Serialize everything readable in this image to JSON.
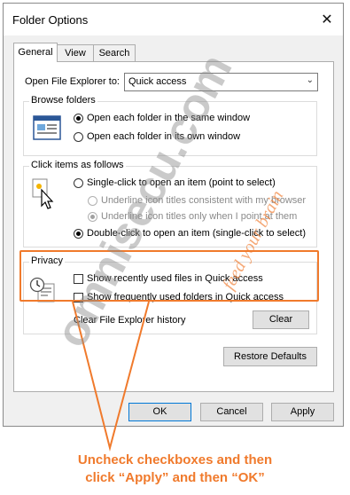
{
  "window": {
    "title": "Folder Options",
    "close_icon": "close-icon"
  },
  "tabs": [
    {
      "label": "General",
      "active": true
    },
    {
      "label": "View",
      "active": false
    },
    {
      "label": "Search",
      "active": false
    }
  ],
  "open_explorer": {
    "label": "Open File Explorer to:",
    "value": "Quick access"
  },
  "browse_folders": {
    "title": "Browse folders",
    "options": [
      {
        "label": "Open each folder in the same window",
        "checked": true
      },
      {
        "label": "Open each folder in its own window",
        "checked": false
      }
    ]
  },
  "click_items": {
    "title": "Click items as follows",
    "single_click": "Single-click to open an item (point to select)",
    "underline_consistent": "Underline icon titles consistent with my browser",
    "underline_point": "Underline icon titles only when I point at them",
    "double_click": "Double-click to open an item (single-click to select)"
  },
  "privacy": {
    "title": "Privacy",
    "recent_files": "Show recently used files in Quick access",
    "frequent_folders": "Show frequently used folders in Quick access",
    "clear_label": "Clear File Explorer history",
    "clear_button": "Clear"
  },
  "buttons": {
    "restore_defaults": "Restore Defaults",
    "ok": "OK",
    "cancel": "Cancel",
    "apply": "Apply"
  },
  "annotation": {
    "line1": "Uncheck checkboxes and then",
    "line2": "click “Apply” and then “OK”",
    "color": "#f07a2c"
  },
  "watermark": {
    "main": "omnisecu.com",
    "tagline": "feed your brain"
  }
}
